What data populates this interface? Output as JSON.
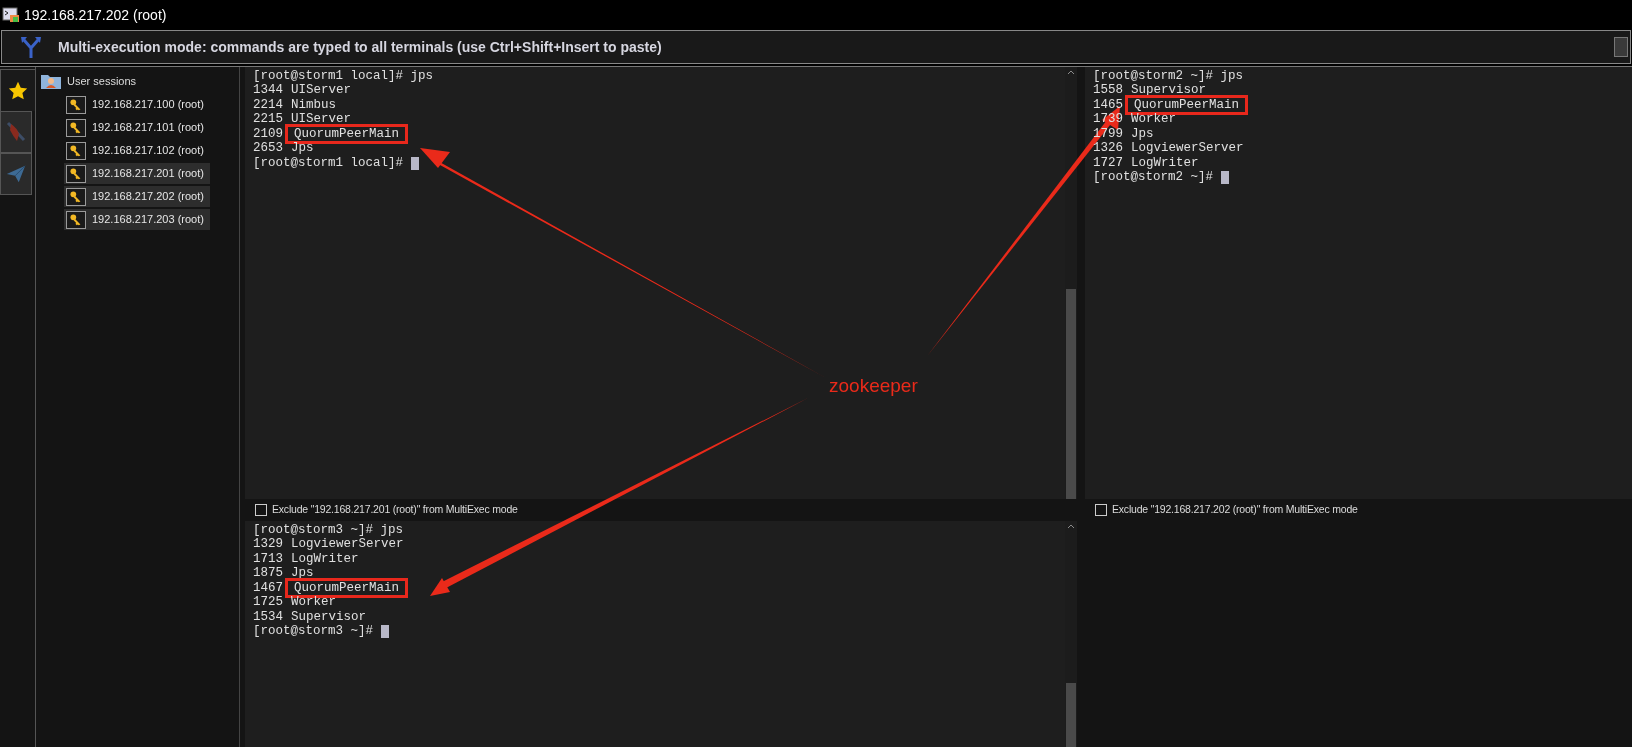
{
  "window": {
    "title": "192.168.217.202 (root)"
  },
  "banner": {
    "text": "Multi-execution mode: commands are typed to all terminals (use Ctrl+Shift+Insert to paste)"
  },
  "side_tabs": [
    {
      "kind": "star",
      "selected": true
    },
    {
      "kind": "tools",
      "selected": false
    },
    {
      "kind": "send",
      "selected": false
    }
  ],
  "sessions": {
    "folder": "User sessions",
    "items": [
      {
        "label": "192.168.217.100 (root)",
        "selected": false
      },
      {
        "label": "192.168.217.101 (root)",
        "selected": false
      },
      {
        "label": "192.168.217.102 (root)",
        "selected": false
      },
      {
        "label": "192.168.217.201 (root)",
        "selected": true
      },
      {
        "label": "192.168.217.202 (root)",
        "selected": true
      },
      {
        "label": "192.168.217.203 (root)",
        "selected": true
      }
    ]
  },
  "terminals": [
    {
      "lines": [
        {
          "kind": "prompt",
          "text": "[root@storm1 local]# jps",
          "cursor": false
        },
        {
          "kind": "process",
          "pid": "1344",
          "name": "UIServer",
          "highlighted": false
        },
        {
          "kind": "process",
          "pid": "2214",
          "name": "Nimbus",
          "highlighted": false
        },
        {
          "kind": "process",
          "pid": "2215",
          "name": "UIServer",
          "highlighted": false
        },
        {
          "kind": "process",
          "pid": "2109",
          "name": "QuorumPeerMain",
          "highlighted": true
        },
        {
          "kind": "process",
          "pid": "2653",
          "name": "Jps",
          "highlighted": false
        },
        {
          "kind": "prompt",
          "text": "[root@storm1 local]#",
          "cursor": true
        }
      ],
      "exclude": {
        "label": "Exclude \"192.168.217.201 (root)\" from MultiExec mode",
        "checked": false
      }
    },
    {
      "lines": [
        {
          "kind": "prompt",
          "text": "[root@storm2 ~]# jps",
          "cursor": false
        },
        {
          "kind": "process",
          "pid": "1558",
          "name": "Supervisor",
          "highlighted": false
        },
        {
          "kind": "process",
          "pid": "1465",
          "name": "QuorumPeerMain",
          "highlighted": true
        },
        {
          "kind": "process",
          "pid": "1739",
          "name": "Worker",
          "highlighted": false
        },
        {
          "kind": "process",
          "pid": "1799",
          "name": "Jps",
          "highlighted": false
        },
        {
          "kind": "process",
          "pid": "1326",
          "name": "LogviewerServer",
          "highlighted": false
        },
        {
          "kind": "process",
          "pid": "1727",
          "name": "LogWriter",
          "highlighted": false
        },
        {
          "kind": "prompt",
          "text": "[root@storm2 ~]#",
          "cursor": true
        }
      ],
      "exclude": {
        "label": "Exclude \"192.168.217.202 (root)\" from MultiExec mode",
        "checked": false
      }
    },
    {
      "lines": [
        {
          "kind": "prompt",
          "text": "[root@storm3 ~]# jps",
          "cursor": false
        },
        {
          "kind": "process",
          "pid": "1329",
          "name": "LogviewerServer",
          "highlighted": false
        },
        {
          "kind": "process",
          "pid": "1713",
          "name": "LogWriter",
          "highlighted": false
        },
        {
          "kind": "process",
          "pid": "1875",
          "name": "Jps",
          "highlighted": false
        },
        {
          "kind": "process",
          "pid": "1467",
          "name": "QuorumPeerMain",
          "highlighted": true
        },
        {
          "kind": "process",
          "pid": "1725",
          "name": "Worker",
          "highlighted": false
        },
        {
          "kind": "process",
          "pid": "1534",
          "name": "Supervisor",
          "highlighted": false
        },
        {
          "kind": "prompt",
          "text": "[root@storm3 ~]#",
          "cursor": true
        }
      ]
    }
  ],
  "annotation": {
    "label": "zookeeper"
  }
}
